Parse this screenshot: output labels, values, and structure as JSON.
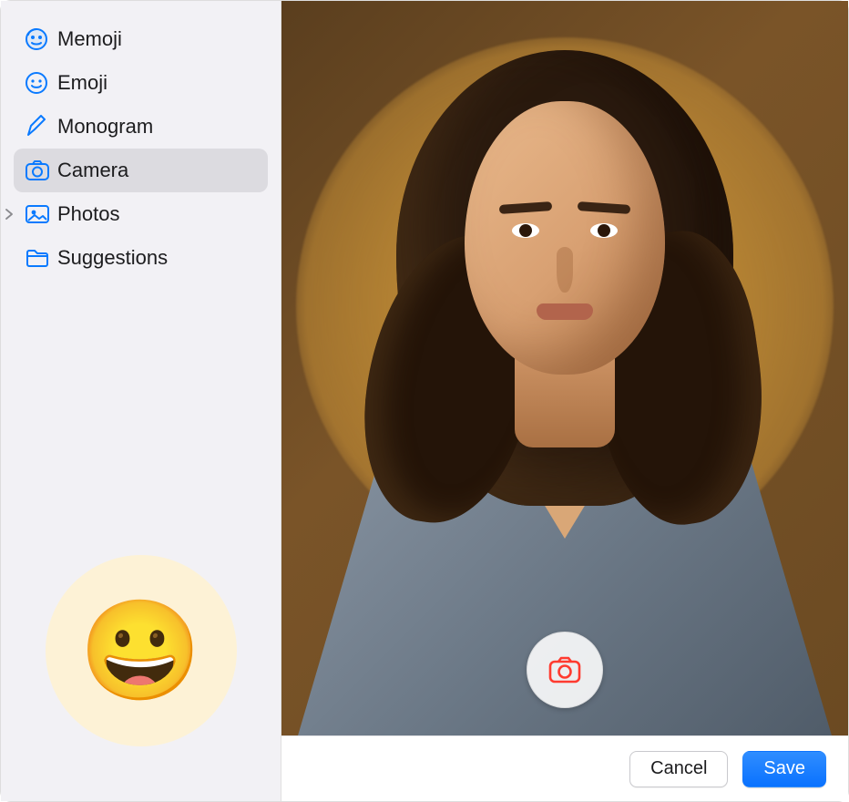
{
  "sidebar": {
    "items": [
      {
        "label": "Memoji",
        "icon": "memoji-face-icon",
        "selected": false,
        "hasDisclosure": false
      },
      {
        "label": "Emoji",
        "icon": "emoji-smile-icon",
        "selected": false,
        "hasDisclosure": false
      },
      {
        "label": "Monogram",
        "icon": "pencil-icon",
        "selected": false,
        "hasDisclosure": false
      },
      {
        "label": "Camera",
        "icon": "camera-icon",
        "selected": true,
        "hasDisclosure": false
      },
      {
        "label": "Photos",
        "icon": "photos-icon",
        "selected": false,
        "hasDisclosure": true
      },
      {
        "label": "Suggestions",
        "icon": "folder-icon",
        "selected": false,
        "hasDisclosure": false
      }
    ],
    "preview": {
      "emoji": "😀",
      "bg": "#fdf2d6"
    }
  },
  "camera": {
    "captureIcon": "camera-capture-icon"
  },
  "footer": {
    "cancel": "Cancel",
    "save": "Save"
  }
}
